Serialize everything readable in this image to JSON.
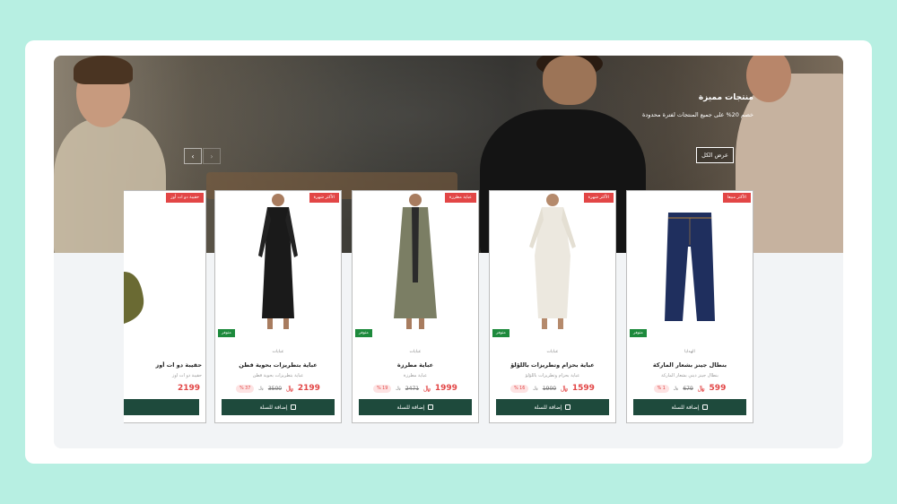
{
  "hero": {
    "title": "منتجات مميزة",
    "subtitle": "خصم 20% على جميع المنتجات لفترة محدودة",
    "view_all": "عرض الكل",
    "prev_icon": "chevron-left-icon",
    "next_icon": "chevron-right-icon"
  },
  "cart_label": "إضافة للسلة",
  "products": [
    {
      "badge": "الأكثر مبيعا",
      "stock": "متوفر",
      "category": "الهدايا",
      "name": "بنطال جينز بشعار الماركة",
      "desc": "بنطال جينز ديني بشعار الماركة",
      "discount": "% 1",
      "old_price": "679",
      "price": "599",
      "color": "#1f2f5e"
    },
    {
      "badge": "الأكثر شهرة",
      "stock": "متوفر",
      "category": "عبايات",
      "name": "عباية بحزام وتطريزات باللؤلؤ",
      "desc": "عباية بحزام وتطريزات باللؤلؤ",
      "discount": "% 16",
      "old_price": "1900",
      "price": "1599",
      "color": "#ece8df"
    },
    {
      "badge": "عباية مطرزة",
      "stock": "متوفر",
      "category": "عبايات",
      "name": "عباية مطرزة",
      "desc": "عباية مطرزة",
      "discount": "% 19",
      "old_price": "2471",
      "price": "1999",
      "color": "#7b7e64"
    },
    {
      "badge": "الأكثر شهرة",
      "stock": "متوفر",
      "category": "عبايات",
      "name": "عباية بتطريزات بحوية قطن",
      "desc": "عباية بتطريزات بحوية قطن",
      "discount": "% 37",
      "old_price": "3500",
      "price": "2199",
      "color": "#1a1a1a"
    },
    {
      "badge": "حقيبة دو ات أوز",
      "stock": "",
      "category": "",
      "name": "حقيبة دو ات أوز",
      "desc": "حقيبة دو ات أوز",
      "discount": "",
      "old_price": "",
      "price": "2199",
      "color": "#6a6a33"
    }
  ]
}
